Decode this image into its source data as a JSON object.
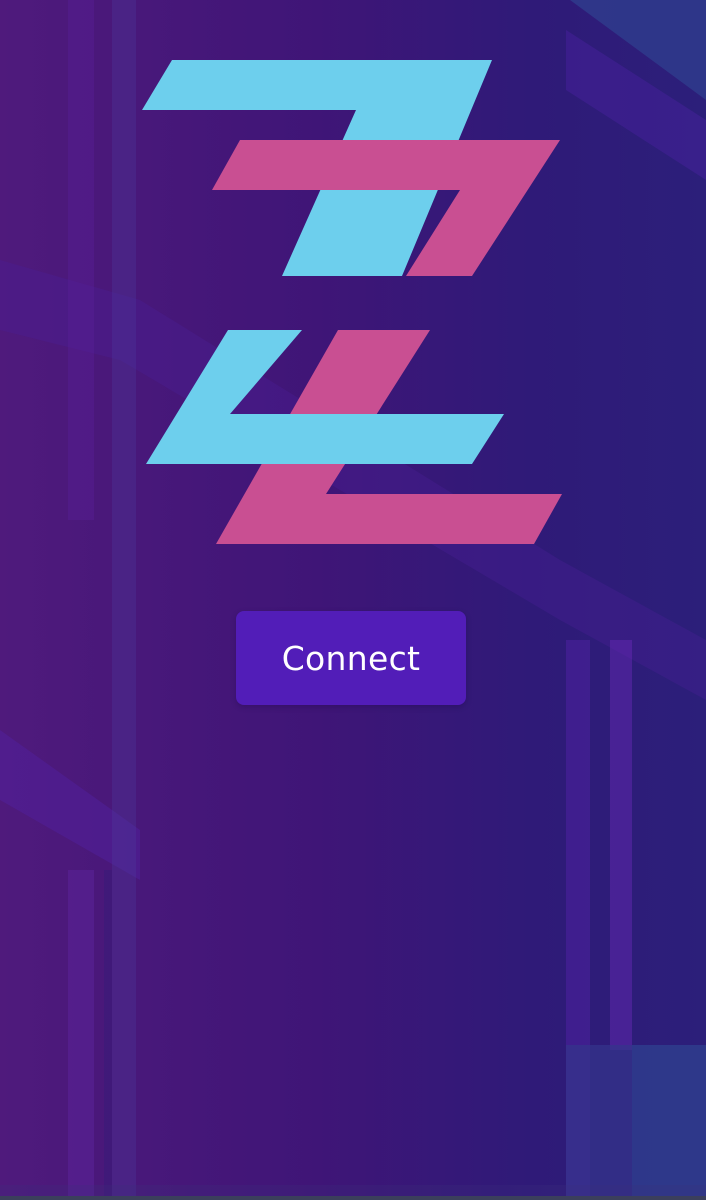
{
  "app": {
    "logo_label": "ZZ logo"
  },
  "actions": {
    "connect_label": "Connect"
  },
  "colors": {
    "background_left": "#4f1a7c",
    "background_right": "#2c1f7a",
    "logo_cyan": "#6dcfed",
    "logo_pink": "#c94f92",
    "button": "#521db8",
    "button_text": "#ffffff"
  },
  "icons": {
    "logo": "stylized-zz-logo"
  }
}
